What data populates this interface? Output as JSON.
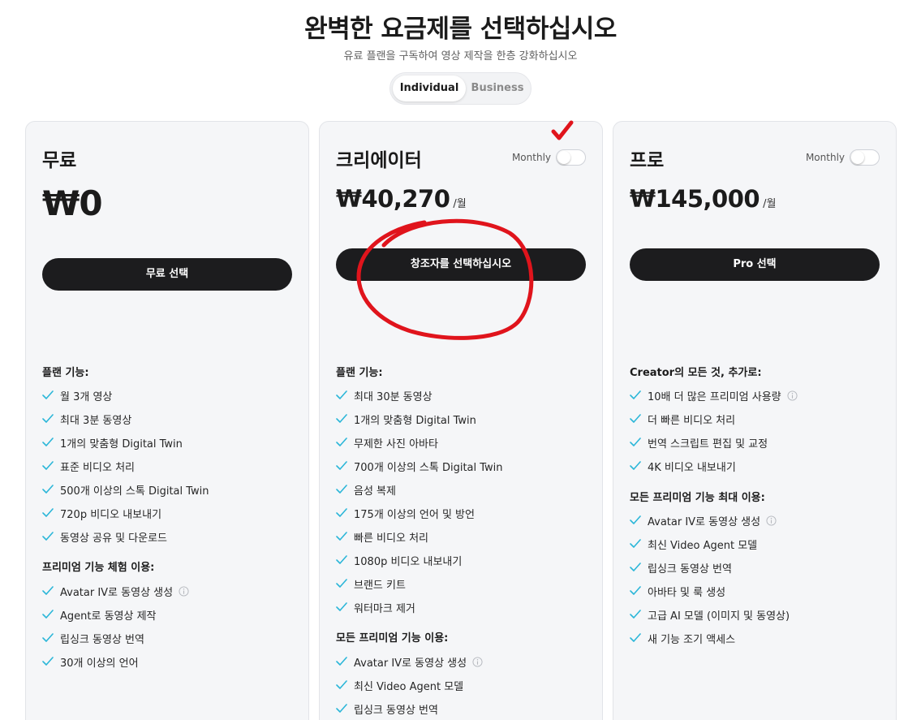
{
  "header": {
    "title": "완벽한 요금제를 선택하십시오",
    "subtitle": "유료 플랜을 구독하여 영상 제작을 한층 강화하십시오"
  },
  "tabs": [
    {
      "label": "Individual",
      "active": true
    },
    {
      "label": "Business",
      "active": false
    }
  ],
  "colors": {
    "accent": "#1c1c1e",
    "check": "#2bb6d8",
    "annotation": "#e0141c"
  },
  "icons": {
    "check": "check-icon",
    "info": "info-icon"
  },
  "plans": {
    "free": {
      "name": "무료",
      "price": "₩0",
      "cta": "무료 선택",
      "section1_title": "플랜 기능:",
      "features": [
        "월 3개 영상",
        "최대 3분 동영상",
        "1개의 맞춤형 Digital Twin",
        "표준 비디오 처리",
        "500개 이상의 스톡 Digital Twin",
        "720p 비디오 내보내기",
        "동영상 공유 및 다운로드"
      ],
      "section2_title": "프리미엄 기능 체험 이용:",
      "premium_features": [
        "Avatar IV로 동영상 생성",
        "Agent로 동영상 제작",
        "립싱크 동영상 번역",
        "30개 이상의 언어"
      ]
    },
    "creator": {
      "name": "크리에이터",
      "billing_label": "Monthly",
      "price": "₩40,270",
      "unit": "/월",
      "cta": "창조자를 선택하십시오",
      "section1_title": "플랜 기능:",
      "features": [
        "최대 30분 동영상",
        "1개의 맞춤형 Digital Twin",
        "무제한 사진 아바타",
        "700개 이상의 스톡 Digital Twin",
        "음성 복제",
        "175개 이상의 언어 및 방언",
        "빠른 비디오 처리",
        "1080p 비디오 내보내기",
        "브랜드 키트",
        "워터마크 제거"
      ],
      "section2_title": "모든 프리미엄 기능 이용:",
      "premium_features": [
        "Avatar IV로 동영상 생성",
        "최신 Video Agent 모델",
        "립싱크 동영상 번역"
      ]
    },
    "pro": {
      "name": "프로",
      "billing_label": "Monthly",
      "price": "₩145,000",
      "unit": "/월",
      "cta": "Pro 선택",
      "section1_title": "Creator의 모든 것, 추가로:",
      "features": [
        "10배 더 많은 프리미엄 사용량",
        "더 빠른 비디오 처리",
        "번역 스크립트 편집 및 교정",
        "4K 비디오 내보내기"
      ],
      "section2_title": "모든 프리미엄 기능 최대 이용:",
      "premium_features": [
        "Avatar IV로 동영상 생성",
        "최신 Video Agent 모델",
        "립싱크 동영상 번역",
        "아바타 및 룩 생성",
        "고급 AI 모델 (이미지 및 동영상)",
        "새 기능 조기 액세스"
      ]
    }
  }
}
